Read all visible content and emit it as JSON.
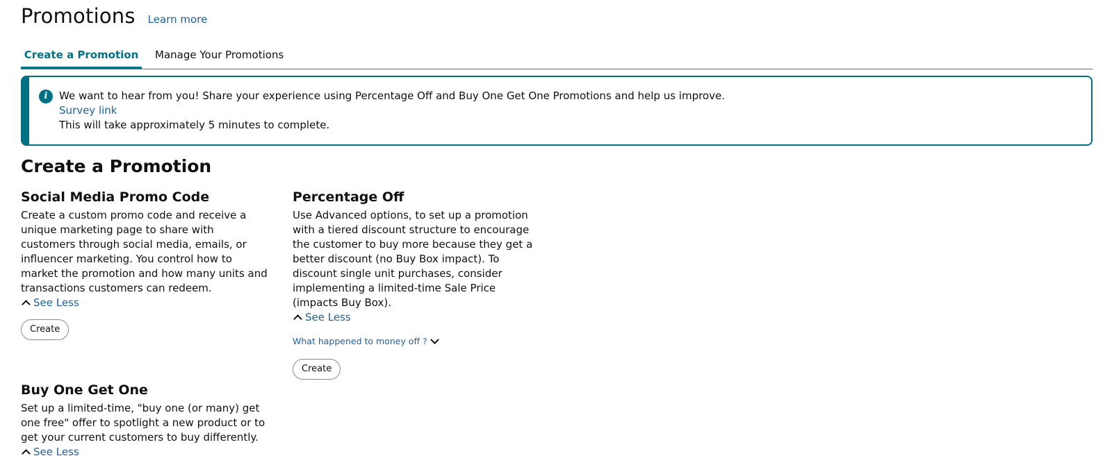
{
  "header": {
    "title": "Promotions",
    "learn_more": "Learn more"
  },
  "tabs": [
    {
      "label": "Create a Promotion",
      "active": true
    },
    {
      "label": "Manage Your Promotions",
      "active": false
    }
  ],
  "alert": {
    "message": "We want to hear from you! Share your experience using Percentage Off and Buy One Get One Promotions and help us improve.",
    "survey_link": "Survey link",
    "duration": "This will take approximately 5 minutes to complete.",
    "icon": "info-icon"
  },
  "section_title": "Create a Promotion",
  "cards": {
    "social": {
      "title": "Social Media Promo Code",
      "description": "Create a custom promo code and receive a unique marketing page to share with customers through social media, emails, or influencer marketing. You control how to market the promotion and how many units and transactions customers can redeem.",
      "see_less": "See Less",
      "button": "Create"
    },
    "percentage": {
      "title": "Percentage Off",
      "description": "Use Advanced options, to set up a promotion with a tiered discount structure to encourage the customer to buy more because they get a better discount (no Buy Box impact). To discount single unit purchases, consider implementing a limited-time Sale Price (impacts Buy Box).",
      "see_less": "See Less",
      "money_link": "What happened to money off ?",
      "button": "Create"
    },
    "bogo": {
      "title": "Buy One Get One",
      "description": "Set up a limited-time, \"buy one (or many) get one free\" offer to spotlight a new product or to get your current customers to buy differently.",
      "see_less": "See Less"
    }
  },
  "colors": {
    "accent": "#007185",
    "link": "#2162a1",
    "text": "#0f1111"
  }
}
